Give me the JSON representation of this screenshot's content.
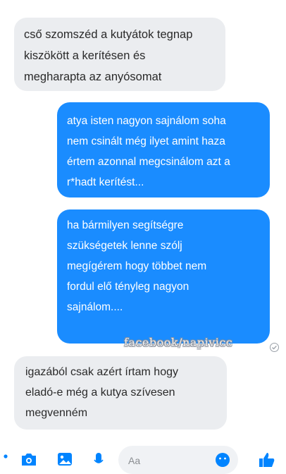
{
  "messages": [
    {
      "type": "received",
      "lines": [
        "cső szomszéd a kutyátok tegnap",
        "kiszökött a kerítésen és",
        "megharapta az anyósomat"
      ]
    },
    {
      "type": "sent",
      "lines": [
        "atya isten nagyon sajnálom soha",
        "nem csinált még ilyet amint haza",
        "értem azonnal megcsinálom azt a",
        "r*hadt kerítést..."
      ]
    },
    {
      "type": "sent",
      "lines": [
        "ha bármilyen segítségre",
        "szükségetek lenne szólj",
        "megígérem hogy többet nem",
        "fordul elő tényleg nagyon",
        "sajnálom...."
      ]
    },
    {
      "type": "received",
      "lines": [
        "igazából csak azért írtam hogy",
        "eladó-e még a kutya szívesen",
        "megvenném"
      ]
    }
  ],
  "watermark": "facebook/napivicc",
  "composer": {
    "placeholder": "Aa",
    "icons": [
      "menu-icon",
      "camera-icon",
      "gallery-icon",
      "microphone-icon",
      "emoji-icon",
      "like-icon"
    ]
  },
  "colors": {
    "sent_bubble": "#1a8cff",
    "received_bubble": "#ebedf0",
    "accent": "#0084ff"
  }
}
